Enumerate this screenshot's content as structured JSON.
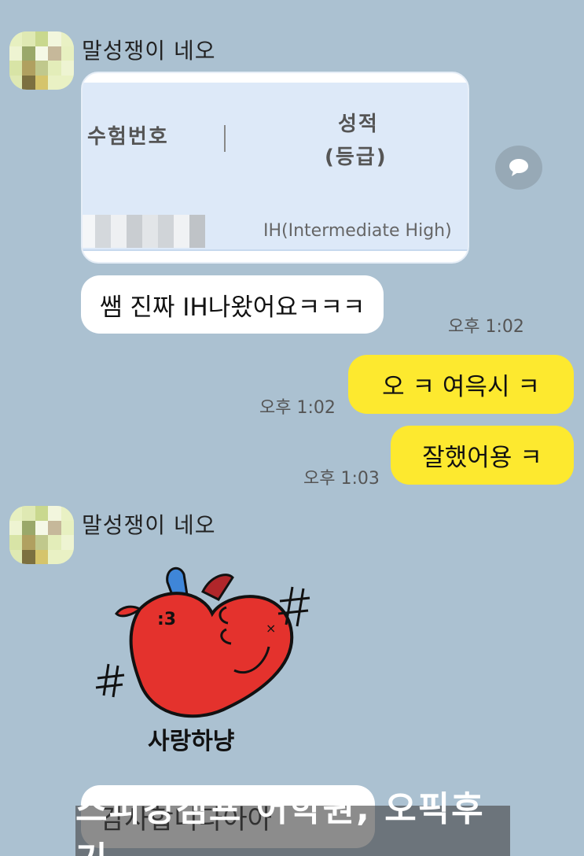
{
  "messages": {
    "sender_name_1": "말성쟁이 네오",
    "sender_name_2": "말성쟁이 네오",
    "card": {
      "col_exam_number": "수험번호",
      "col_score_line1": "성적",
      "col_score_line2": "(등급)",
      "grade_value": "IH(Intermediate High)"
    },
    "msg1": {
      "text": "쌤 진짜 IH나왔어요ㅋㅋㅋ",
      "time": "오후 1:02"
    },
    "msg2": {
      "text": "오 ㅋ 여윽시 ㅋ",
      "time": "오후 1:02"
    },
    "msg3": {
      "text": "잘했어용 ㅋ",
      "time": "오후 1:03"
    },
    "sticker_caption": "사랑하냥",
    "msg4_partial": "감사합니다아아"
  },
  "overlay": {
    "banner_text": "스피킹캠프 어학원, 오픽후기"
  },
  "icons": {
    "share": "share-icon",
    "chat_bubble": "speech-bubble-icon"
  },
  "colors": {
    "background": "#abc1d1",
    "my_bubble": "#fde92f",
    "other_bubble": "#ffffff"
  }
}
